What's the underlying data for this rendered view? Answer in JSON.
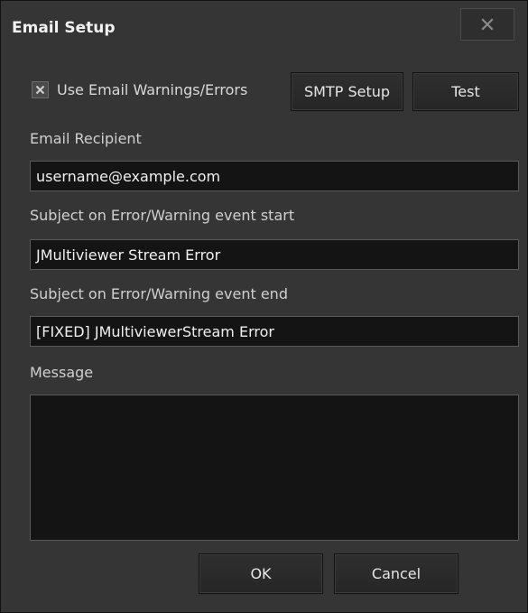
{
  "dialog": {
    "title": "Email Setup",
    "close_icon": "close-icon"
  },
  "options": {
    "use_email_label": "Use Email Warnings/Errors",
    "use_email_checked": true,
    "smtp_setup_label": "SMTP Setup",
    "test_label": "Test"
  },
  "fields": {
    "recipient_label": "Email Recipient",
    "recipient_value": "username@example.com",
    "subject_start_label": "Subject on Error/Warning event start",
    "subject_start_value": "JMultiviewer Stream Error",
    "subject_end_label": "Subject on Error/Warning event end",
    "subject_end_value": "[FIXED] JMultiviewerStream Error",
    "message_label": "Message",
    "message_value": ""
  },
  "footer": {
    "ok_label": "OK",
    "cancel_label": "Cancel"
  },
  "colors": {
    "background": "#353535",
    "field_background": "#141414",
    "text": "#d9d9d9"
  }
}
